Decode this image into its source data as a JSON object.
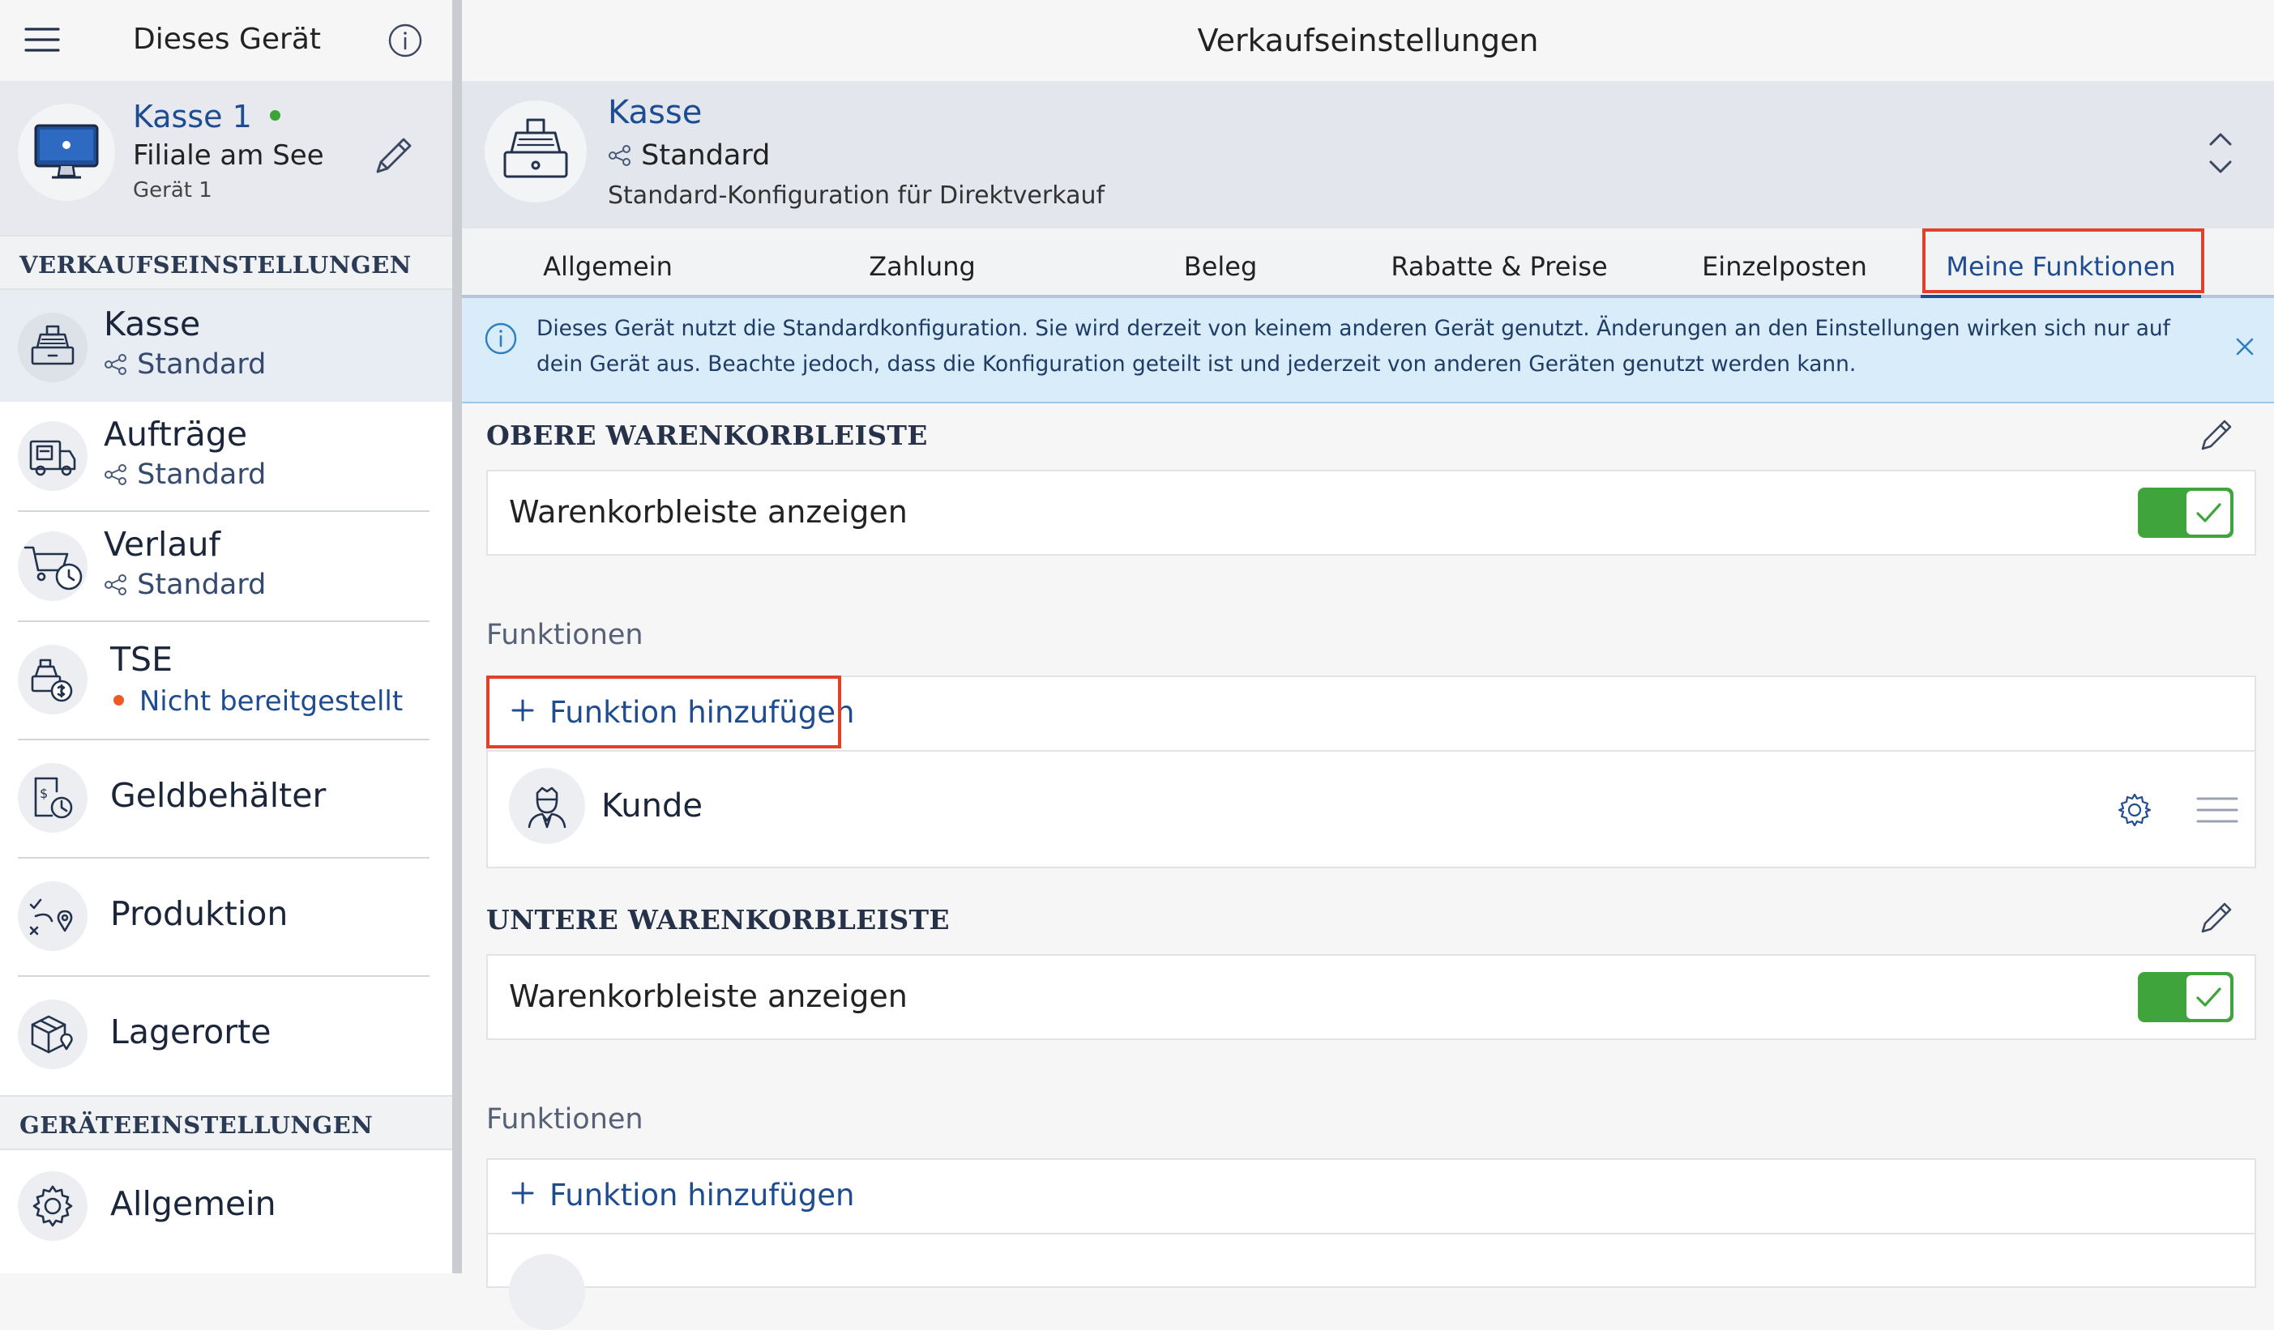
{
  "sidebar": {
    "header_title": "Dieses Gerät",
    "device": {
      "name": "Kasse 1",
      "branch": "Filiale am See",
      "device_label": "Gerät 1",
      "status_color": "#3aa33a"
    },
    "section_sales": "VERKAUFSEINSTELLUNGEN",
    "items": [
      {
        "label": "Kasse",
        "sub": "Standard",
        "icon": "cash-register-icon"
      },
      {
        "label": "Aufträge",
        "sub": "Standard",
        "icon": "delivery-truck-icon"
      },
      {
        "label": "Verlauf",
        "sub": "Standard",
        "icon": "cart-history-icon"
      },
      {
        "label": "TSE",
        "sub": "Nicht bereitgestellt",
        "icon": "tse-icon",
        "status_color": "#ee5a24"
      },
      {
        "label": "Geldbehälter",
        "icon": "cash-box-icon"
      },
      {
        "label": "Produktion",
        "icon": "production-route-icon"
      },
      {
        "label": "Lagerorte",
        "icon": "storage-location-icon"
      }
    ],
    "section_device": "GERÄTEEINSTELLUNGEN",
    "device_items": [
      {
        "label": "Allgemein",
        "icon": "gear-icon"
      }
    ]
  },
  "main": {
    "title": "Verkaufseinstellungen",
    "config": {
      "name": "Kasse",
      "profile": "Standard",
      "description": "Standard-Konfiguration für Direktverkauf"
    },
    "tabs": [
      "Allgemein",
      "Zahlung",
      "Beleg",
      "Rabatte & Preise",
      "Einzelposten",
      "Meine Funktionen"
    ],
    "active_tab": "Meine Funktionen",
    "info_text_line1": "Dieses Gerät nutzt die Standardkonfiguration. Sie wird derzeit von keinem anderen Gerät genutzt. Änderungen an den Einstellungen wirken sich nur auf",
    "info_text_line2": "dein Gerät aus. Beachte jedoch, dass die Konfiguration geteilt ist und jederzeit von anderen Geräten genutzt werden kann.",
    "upper": {
      "heading": "OBERE WARENKORBLEISTE",
      "toggle_label": "Warenkorbleiste anzeigen",
      "toggle_on": true,
      "functions_label": "Funktionen",
      "add_label": "Funktion hinzufügen",
      "functions": [
        {
          "label": "Kunde",
          "icon": "customer-icon"
        }
      ]
    },
    "lower": {
      "heading": "UNTERE WARENKORBLEISTE",
      "toggle_label": "Warenkorbleiste anzeigen",
      "toggle_on": true,
      "functions_label": "Funktionen",
      "add_label": "Funktion hinzufügen"
    },
    "colors": {
      "accent": "#1e4c91",
      "toggle_on": "#3fa43b",
      "highlight": "#e0412b",
      "info_bg": "#d9ecf9"
    }
  }
}
